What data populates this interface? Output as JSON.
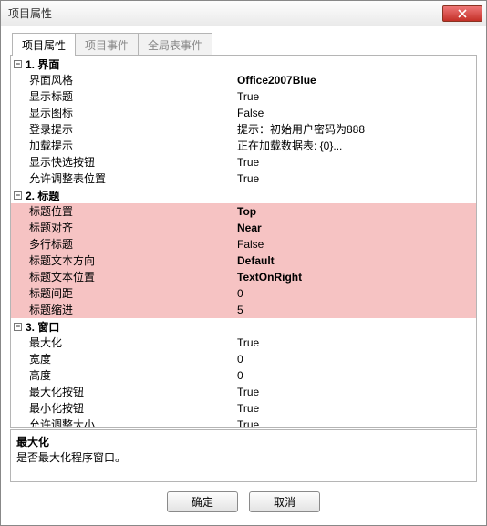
{
  "window": {
    "title": "项目属性"
  },
  "tabs": [
    {
      "label": "项目属性",
      "active": true
    },
    {
      "label": "项目事件",
      "active": false
    },
    {
      "label": "全局表事件",
      "active": false
    }
  ],
  "groups": [
    {
      "title": "1. 界面",
      "highlight": false,
      "rows": [
        {
          "label": "界面风格",
          "value": "Office2007Blue",
          "bold": true
        },
        {
          "label": "显示标题",
          "value": "True"
        },
        {
          "label": "显示图标",
          "value": "False"
        },
        {
          "label": "登录提示",
          "value": "提示：初始用户密码为888"
        },
        {
          "label": "加载提示",
          "value": "正在加载数据表: {0}..."
        },
        {
          "label": "显示快选按钮",
          "value": "True"
        },
        {
          "label": "允许调整表位置",
          "value": "True"
        }
      ]
    },
    {
      "title": "2. 标题",
      "highlight": true,
      "rows": [
        {
          "label": "标题位置",
          "value": "Top",
          "bold": true
        },
        {
          "label": "标题对齐",
          "value": "Near",
          "bold": true
        },
        {
          "label": "多行标题",
          "value": "False"
        },
        {
          "label": "标题文本方向",
          "value": "Default",
          "bold": true
        },
        {
          "label": "标题文本位置",
          "value": "TextOnRight",
          "bold": true
        },
        {
          "label": "标题间距",
          "value": "0"
        },
        {
          "label": "标题缩进",
          "value": "5"
        }
      ]
    },
    {
      "title": "3. 窗口",
      "highlight": false,
      "rows": [
        {
          "label": "最大化",
          "value": "True",
          "selected": true
        },
        {
          "label": "宽度",
          "value": "0"
        },
        {
          "label": "高度",
          "value": "0"
        },
        {
          "label": "最大化按钮",
          "value": "True"
        },
        {
          "label": "最小化按钮",
          "value": "True"
        },
        {
          "label": "允许调整大小",
          "value": "True"
        }
      ]
    }
  ],
  "description": {
    "title": "最大化",
    "text": "是否最大化程序窗口。"
  },
  "buttons": {
    "ok": "确定",
    "cancel": "取消"
  }
}
